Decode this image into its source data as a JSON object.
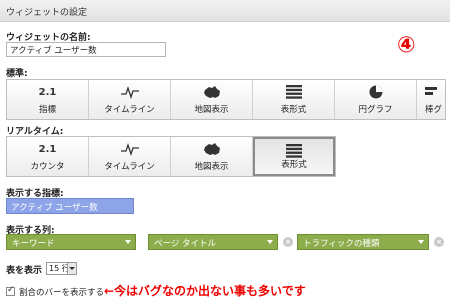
{
  "window": {
    "title": "ウィジェットの設定"
  },
  "annotation_number": "④",
  "widget_name": {
    "label": "ウィジェットの名前:",
    "value": "アクティブ ユーザー数"
  },
  "standard": {
    "label": "標準:",
    "tiles": [
      {
        "icon_text": "2.1",
        "icon": "number-icon",
        "label": "指標"
      },
      {
        "icon": "timeline-icon",
        "label": "タイムライン"
      },
      {
        "icon": "map-icon",
        "label": "地図表示"
      },
      {
        "icon": "table-icon",
        "label": "表形式"
      },
      {
        "icon": "pie-chart-icon",
        "label": "円グラフ"
      },
      {
        "icon": "bar-icon",
        "label": "棒グ"
      }
    ]
  },
  "realtime": {
    "label": "リアルタイム:",
    "tiles": [
      {
        "icon_text": "2.1",
        "icon": "number-icon",
        "label": "カウンタ"
      },
      {
        "icon": "timeline-icon",
        "label": "タイムライン"
      },
      {
        "icon": "map-icon",
        "label": "地図表示"
      },
      {
        "icon": "table-icon",
        "label": "表形式",
        "selected": true
      }
    ]
  },
  "metric": {
    "label": "表示する指標:",
    "value": "アクティブ ユーザー数"
  },
  "columns": {
    "label": "表示する列:",
    "items": [
      "キーワード",
      "ページ タイトル",
      "トラフィックの種類"
    ]
  },
  "rows": {
    "label": "表を表示",
    "value": "15 行"
  },
  "percent_bar": {
    "label": "割合のバーを表示する",
    "checked": true
  },
  "annotation_text": "←今はバグなのか出ない事も多いです",
  "colors": {
    "metric": "#8ea4e8",
    "pill": "#8dad4c",
    "annotation": "#ee0000"
  }
}
